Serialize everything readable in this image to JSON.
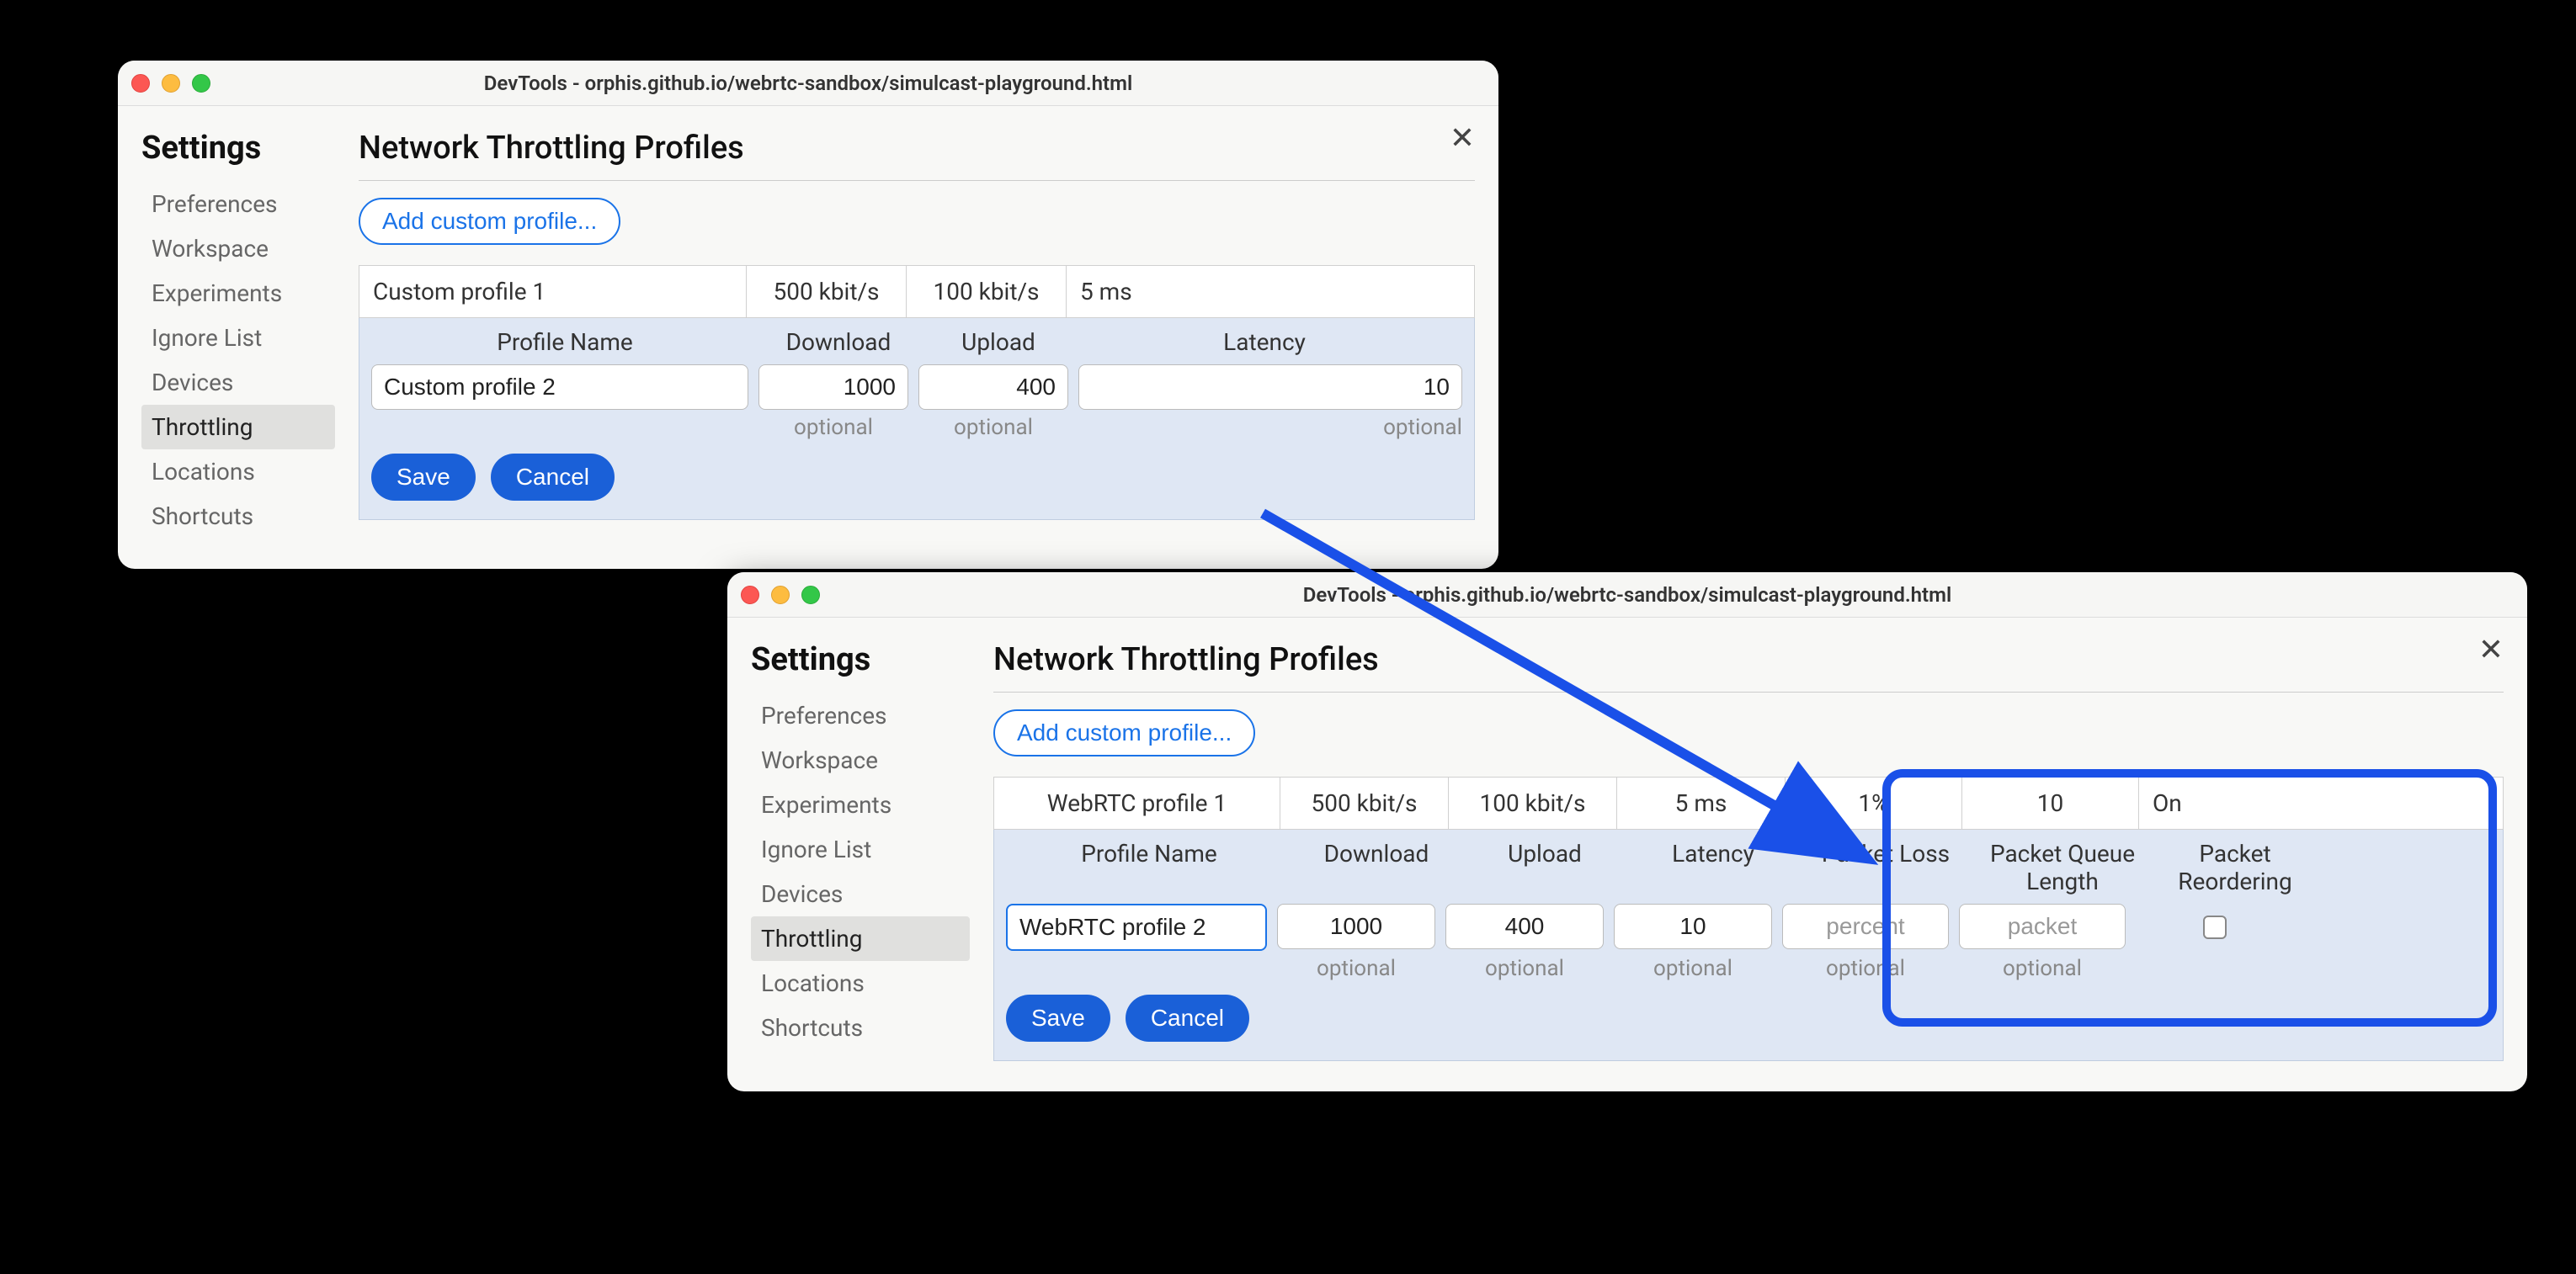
{
  "window1": {
    "title": "DevTools - orphis.github.io/webrtc-sandbox/simulcast-playground.html",
    "settings_heading": "Settings",
    "sidebar": [
      "Preferences",
      "Workspace",
      "Experiments",
      "Ignore List",
      "Devices",
      "Throttling",
      "Locations",
      "Shortcuts"
    ],
    "active_sidebar_index": 5,
    "main_heading": "Network Throttling Profiles",
    "add_button": "Add custom profile...",
    "profile_row": {
      "name": "Custom profile 1",
      "download": "500 kbit/s",
      "upload": "100 kbit/s",
      "latency": "5 ms"
    },
    "edit_headers": {
      "name": "Profile Name",
      "download": "Download",
      "upload": "Upload",
      "latency": "Latency"
    },
    "edit_values": {
      "name": "Custom profile 2",
      "download": "1000",
      "upload": "400",
      "latency": "10"
    },
    "hint": "optional",
    "save_label": "Save",
    "cancel_label": "Cancel"
  },
  "window2": {
    "title": "DevTools - orphis.github.io/webrtc-sandbox/simulcast-playground.html",
    "settings_heading": "Settings",
    "sidebar": [
      "Preferences",
      "Workspace",
      "Experiments",
      "Ignore List",
      "Devices",
      "Throttling",
      "Locations",
      "Shortcuts"
    ],
    "active_sidebar_index": 5,
    "main_heading": "Network Throttling Profiles",
    "add_button": "Add custom profile...",
    "profile_row": {
      "name": "WebRTC profile 1",
      "download": "500 kbit/s",
      "upload": "100 kbit/s",
      "latency": "5 ms",
      "loss": "1%",
      "queue": "10",
      "reorder": "On"
    },
    "edit_headers": {
      "name": "Profile Name",
      "download": "Download",
      "upload": "Upload",
      "latency": "Latency",
      "loss": "Packet Loss",
      "queue": "Packet Queue Length",
      "reorder": "Packet Reordering"
    },
    "edit_values": {
      "name": "WebRTC profile 2",
      "download": "1000",
      "upload": "400",
      "latency": "10"
    },
    "placeholders": {
      "loss": "percent",
      "queue": "packet"
    },
    "hint": "optional",
    "save_label": "Save",
    "cancel_label": "Cancel"
  }
}
